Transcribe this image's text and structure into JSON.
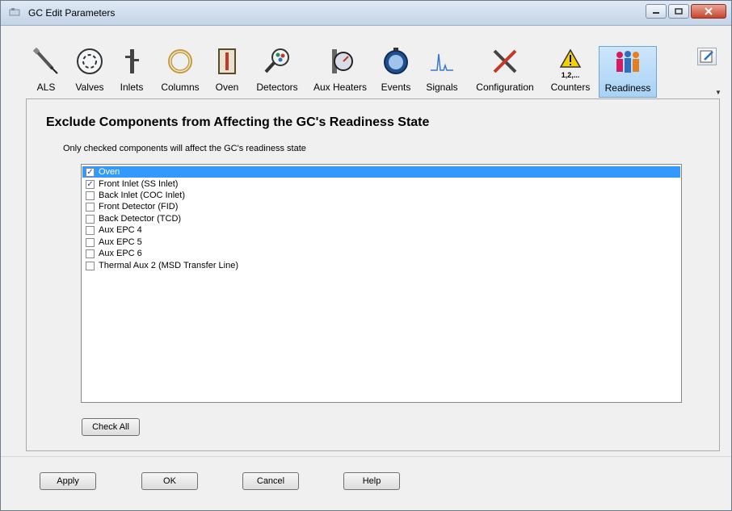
{
  "window": {
    "title": "GC Edit Parameters"
  },
  "toolbar": {
    "items": [
      {
        "label": "ALS",
        "icon": "syringe-icon"
      },
      {
        "label": "Valves",
        "icon": "valve-icon"
      },
      {
        "label": "Inlets",
        "icon": "inlet-icon"
      },
      {
        "label": "Columns",
        "icon": "column-coil-icon"
      },
      {
        "label": "Oven",
        "icon": "oven-icon"
      },
      {
        "label": "Detectors",
        "icon": "detector-magnifier-icon"
      },
      {
        "label": "Aux Heaters",
        "icon": "aux-heater-icon"
      },
      {
        "label": "Events",
        "icon": "stopwatch-icon"
      },
      {
        "label": "Signals",
        "icon": "signal-peak-icon"
      },
      {
        "label": "Configuration",
        "icon": "tools-icon"
      },
      {
        "label": "Counters",
        "icon": "warning-counter-icon",
        "badge": "1,2,..."
      },
      {
        "label": "Readiness",
        "icon": "readiness-people-icon",
        "active": true
      }
    ]
  },
  "page": {
    "heading": "Exclude Components from Affecting the GC's Readiness State",
    "subtext": "Only checked components will affect the GC's readiness state"
  },
  "components": [
    {
      "label": "Oven",
      "checked": true,
      "selected": true
    },
    {
      "label": "Front Inlet (SS Inlet)",
      "checked": true
    },
    {
      "label": "Back Inlet (COC Inlet)",
      "checked": false
    },
    {
      "label": "Front Detector (FID)",
      "checked": false
    },
    {
      "label": "Back Detector (TCD)",
      "checked": false
    },
    {
      "label": "Aux EPC 4",
      "checked": false
    },
    {
      "label": "Aux EPC 5",
      "checked": false
    },
    {
      "label": "Aux EPC 6",
      "checked": false
    },
    {
      "label": "Thermal Aux 2 (MSD Transfer Line)",
      "checked": false
    }
  ],
  "buttons": {
    "check_all": "Check All",
    "apply": "Apply",
    "ok": "OK",
    "cancel": "Cancel",
    "help": "Help"
  },
  "colors": {
    "selection": "#3399ff",
    "active_tab": "#a8d2f5"
  }
}
